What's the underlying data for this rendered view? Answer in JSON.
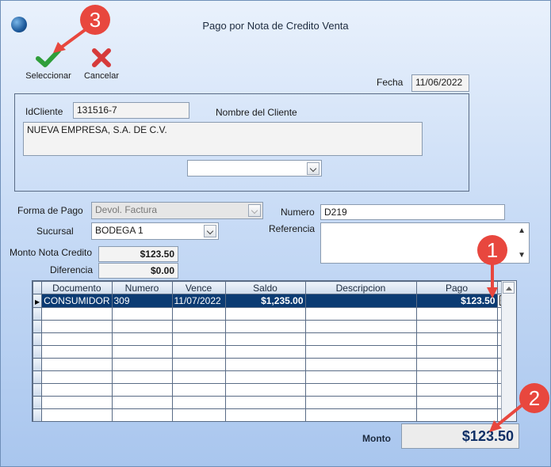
{
  "window": {
    "title": "Pago por Nota de Credito Venta"
  },
  "toolbar": {
    "select_label": "Seleccionar",
    "cancel_label": "Cancelar"
  },
  "fecha": {
    "label": "Fecha",
    "value": "11/06/2022"
  },
  "cliente": {
    "id_label": "IdCliente",
    "id_value": "131516-7",
    "name_label": "Nombre del Cliente",
    "name_value": "NUEVA EMPRESA, S.A. DE C.V.",
    "combo_value": ""
  },
  "pago": {
    "forma_label": "Forma de Pago",
    "forma_value": "Devol. Factura",
    "sucursal_label": "Sucursal",
    "sucursal_value": "BODEGA 1",
    "numero_label": "Numero",
    "numero_value": "D219",
    "referencia_label": "Referencia",
    "referencia_value": "",
    "monto_nota_label": "Monto Nota Credito",
    "monto_nota_value": "$123.50",
    "diferencia_label": "Diferencia",
    "diferencia_value": "$0.00"
  },
  "grid": {
    "columns": [
      "Documento",
      "Numero",
      "Vence",
      "Saldo",
      "Descripcion",
      "Pago"
    ],
    "rows": [
      {
        "documento": "CONSUMIDOR",
        "numero": "309",
        "vence": "11/07/2022",
        "saldo": "$1,235.00",
        "descripcion": "",
        "pago": "$123.50",
        "checked": true
      }
    ]
  },
  "total": {
    "label": "Monto",
    "value": "$123.50"
  },
  "callouts": [
    "1",
    "2",
    "3"
  ],
  "colors": {
    "badge": "#e8473e",
    "selected_row": "#0b3b73",
    "accept": "#2f9e3a",
    "cancel": "#d63a3a"
  }
}
